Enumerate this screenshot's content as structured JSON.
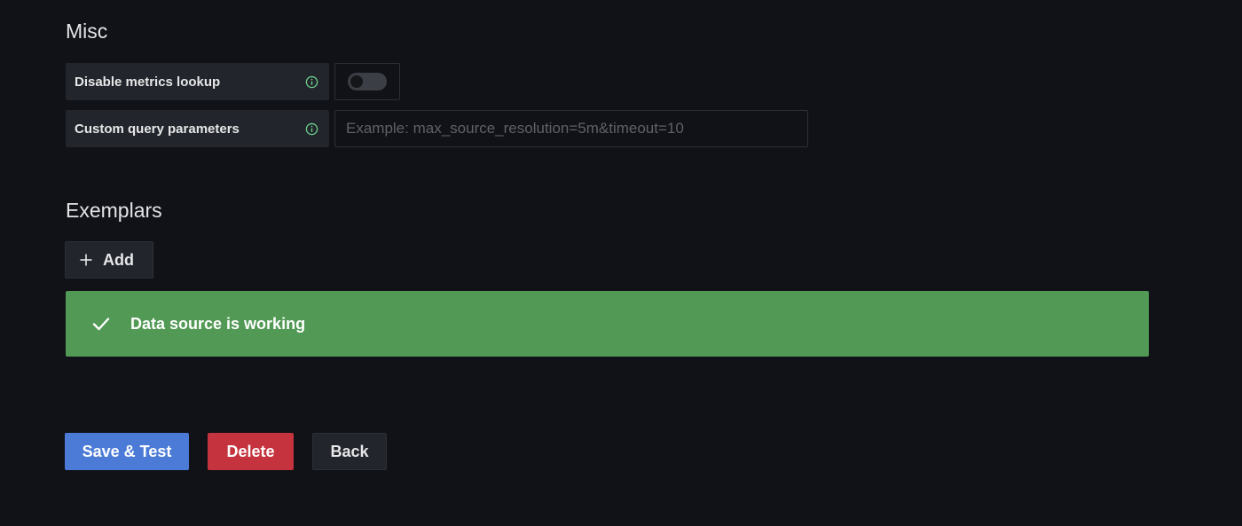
{
  "misc": {
    "title": "Misc",
    "disable_metrics_lookup": {
      "label": "Disable metrics lookup",
      "info_icon": "info-circle-icon",
      "enabled": false
    },
    "custom_query_parameters": {
      "label": "Custom query parameters",
      "info_icon": "info-circle-icon",
      "value": "",
      "placeholder": "Example: max_source_resolution=5m&timeout=10"
    }
  },
  "exemplars": {
    "title": "Exemplars",
    "add_label": "Add",
    "add_icon": "plus-icon"
  },
  "alert": {
    "icon": "check-icon",
    "message": "Data source is working",
    "color": "#519954"
  },
  "actions": {
    "save_test_label": "Save & Test",
    "delete_label": "Delete",
    "back_label": "Back"
  },
  "colors": {
    "background": "#111217",
    "primary": "#4b7bd6",
    "destructive": "#c4333e",
    "success": "#519954",
    "info_icon": "#6ccf8e"
  }
}
